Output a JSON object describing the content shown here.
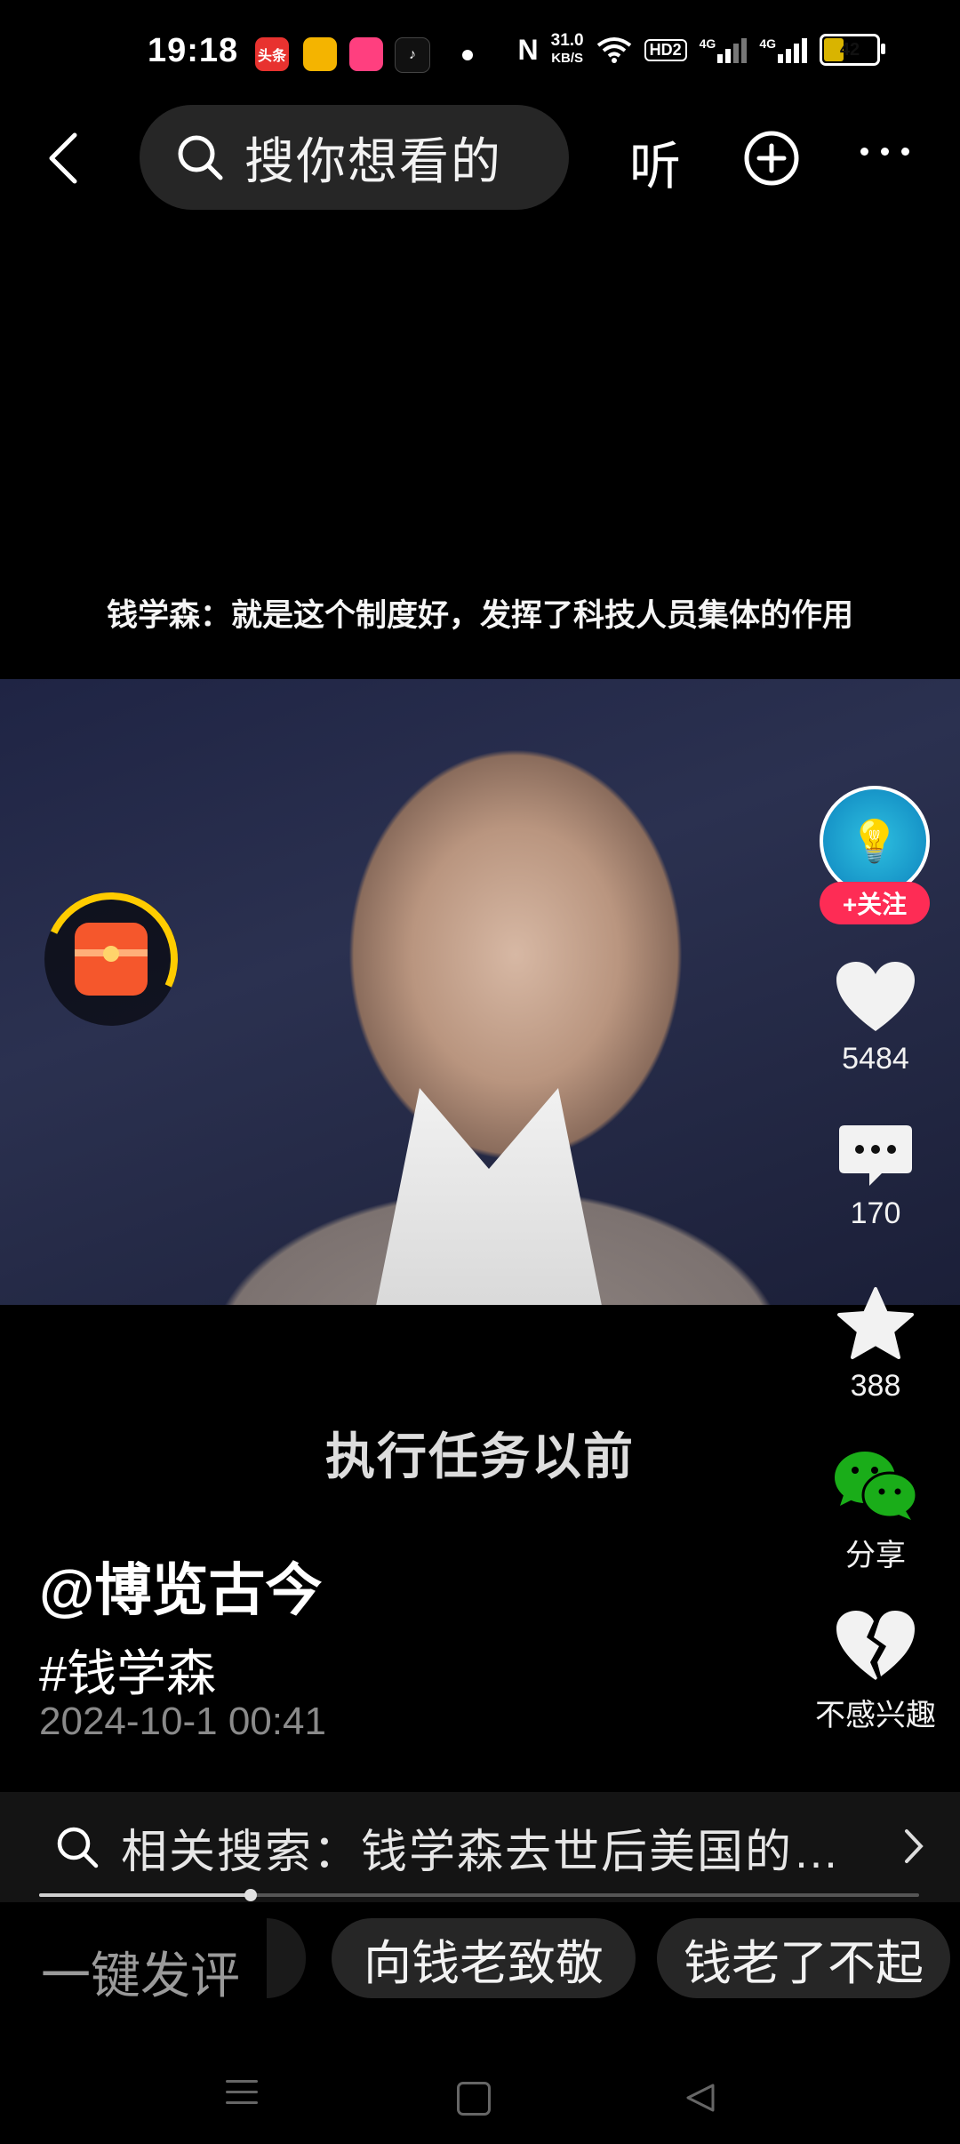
{
  "status_bar": {
    "time": "19:18",
    "app_icons": [
      "头条",
      "",
      "",
      ""
    ],
    "net_speed_value": "31.0",
    "net_speed_unit": "KB/S",
    "hd_label": "HD2",
    "sim1_label": "4G",
    "sim2_label": "4G",
    "battery": "42",
    "battery_level": 0.42
  },
  "top_nav": {
    "search_placeholder": "搜你想看的",
    "listen_label": "听"
  },
  "video": {
    "caption_top": "钱学森：就是这个制度好，发挥了科技人员集体的作用",
    "caption_bottom": "执行任务以前"
  },
  "side_actions": {
    "follow_label": "+关注",
    "likes": "5484",
    "comments": "170",
    "favorites": "388",
    "share_label": "分享",
    "not_interested_label": "不感兴趣"
  },
  "post": {
    "author": "@博览古今",
    "hashtag": "#钱学森",
    "datetime": "2024-10-1 00:41"
  },
  "related_search": {
    "text": "相关搜索：钱学森去世后美国的…"
  },
  "playback": {
    "progress": 0.24
  },
  "comment_bar": {
    "quick_comment": "一键发评",
    "chips": [
      "向钱老致敬",
      "钱老了不起"
    ]
  },
  "colors": {
    "accent_red": "#fe2c55",
    "background": "#000000"
  }
}
